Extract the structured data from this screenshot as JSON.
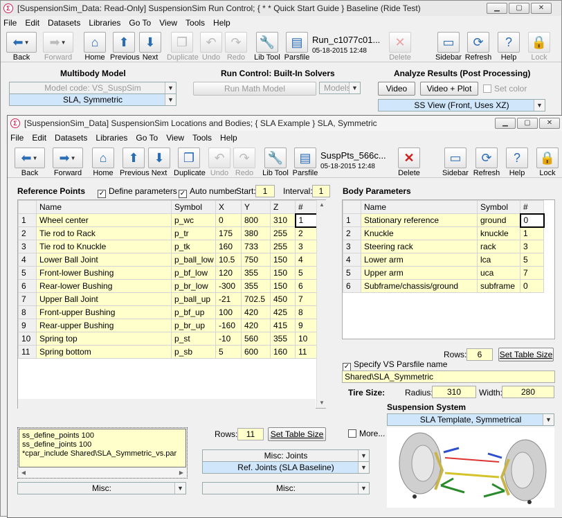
{
  "back_window": {
    "title": "[SuspensionSim_Data: Read-Only] SuspensionSim Run Control; { * * Quick Start Guide } Baseline (Ride Test)",
    "menu": [
      "File",
      "Edit",
      "Datasets",
      "Libraries",
      "Go To",
      "View",
      "Tools",
      "Help"
    ],
    "toolbar": {
      "back": "Back",
      "forward": "Forward",
      "home": "Home",
      "previous": "Previous",
      "next": "Next",
      "duplicate": "Duplicate",
      "undo": "Undo",
      "redo": "Redo",
      "lib_tool": "Lib Tool",
      "parsfile": "Parsfile",
      "dataset_name": "Run_c1077c01...",
      "dataset_date": "05-18-2015 12:48",
      "delete": "Delete",
      "sidebar": "Sidebar",
      "refresh": "Refresh",
      "help": "Help",
      "lock": "Lock"
    },
    "multibody": {
      "heading": "Multibody Model",
      "model_code": "Model code: VS_SuspSim",
      "model_link": "SLA, Symmetric"
    },
    "run_control": {
      "heading": "Run Control: Built-In Solvers",
      "run_button": "Run Math Model",
      "models": "Models"
    },
    "analyze": {
      "heading": "Analyze Results (Post Processing)",
      "video": "Video",
      "video_plot": "Video + Plot",
      "set_color": "Set color",
      "view": "SS View (Front, Uses XZ)"
    }
  },
  "front_window": {
    "title": "[SuspensionSim_Data] SuspensionSim Locations and Bodies; { SLA Example } SLA, Symmetric",
    "menu": [
      "File",
      "Edit",
      "Datasets",
      "Libraries",
      "Go To",
      "View",
      "Tools",
      "Help"
    ],
    "toolbar": {
      "back": "Back",
      "forward": "Forward",
      "home": "Home",
      "previous": "Previous",
      "next": "Next",
      "duplicate": "Duplicate",
      "undo": "Undo",
      "redo": "Redo",
      "lib_tool": "Lib Tool",
      "parsfile": "Parsfile",
      "dataset_name": "SuspPts_566c...",
      "dataset_date": "05-18-2015 12:48",
      "delete": "Delete",
      "sidebar": "Sidebar",
      "refresh": "Refresh",
      "help": "Help",
      "lock": "Lock"
    },
    "ref_points": {
      "heading": "Reference Points",
      "define_params": "Define parameters",
      "auto_number": "Auto number",
      "start_label": "Start:",
      "start_value": "1",
      "interval_label": "Interval:",
      "interval_value": "1",
      "columns": [
        "Name",
        "Symbol",
        "X",
        "Y",
        "Z",
        "#"
      ],
      "rows": [
        [
          "1",
          "Wheel center",
          "p_wc",
          "0",
          "800",
          "310",
          "1"
        ],
        [
          "2",
          "Tie rod to Rack",
          "p_tr",
          "175",
          "380",
          "255",
          "2"
        ],
        [
          "3",
          "Tie rod to Knuckle",
          "p_tk",
          "160",
          "733",
          "255",
          "3"
        ],
        [
          "4",
          "Lower Ball Joint",
          "p_ball_low",
          "10.5",
          "750",
          "150",
          "4"
        ],
        [
          "5",
          "Front-lower Bushing",
          "p_bf_low",
          "120",
          "355",
          "150",
          "5"
        ],
        [
          "6",
          "Rear-lower Bushing",
          "p_br_low",
          "-300",
          "355",
          "150",
          "6"
        ],
        [
          "7",
          "Upper Ball Joint",
          "p_ball_up",
          "-21",
          "702.5",
          "450",
          "7"
        ],
        [
          "8",
          "Front-upper Bushing",
          "p_bf_up",
          "100",
          "420",
          "425",
          "8"
        ],
        [
          "9",
          "Rear-upper Bushing",
          "p_br_up",
          "-160",
          "420",
          "415",
          "9"
        ],
        [
          "10",
          "Spring top",
          "p_st",
          "-10",
          "560",
          "355",
          "10"
        ],
        [
          "11",
          "Spring bottom",
          "p_sb",
          "5",
          "600",
          "160",
          "11"
        ]
      ],
      "rows_label": "Rows:",
      "rows_value": "11",
      "set_table_size": "Set Table Size"
    },
    "misc_text": [
      "ss_define_points 100",
      "ss_define_joints 100",
      "*cpar_include Shared\\SLA_Symmetric_vs.par"
    ],
    "more": "More...",
    "misc_joints": "Misc: Joints",
    "ref_joints": "Ref. Joints (SLA Baseline)",
    "misc1": "Misc:",
    "misc2": "Misc:",
    "body_params": {
      "heading": "Body Parameters",
      "columns": [
        "Name",
        "Symbol",
        "#"
      ],
      "rows": [
        [
          "1",
          "Stationary reference",
          "ground",
          "0"
        ],
        [
          "2",
          "Knuckle",
          "knuckle",
          "1"
        ],
        [
          "3",
          "Steering rack",
          "rack",
          "3"
        ],
        [
          "4",
          "Lower arm",
          "lca",
          "5"
        ],
        [
          "5",
          "Upper arm",
          "uca",
          "7"
        ],
        [
          "6",
          "Subframe/chassis/ground",
          "subframe",
          "0"
        ]
      ],
      "rows_label": "Rows:",
      "rows_value": "6",
      "set_table_size": "Set Table Size"
    },
    "parsfile": {
      "specify_label": "Specify VS Parsfile name",
      "name": "Shared\\SLA_Symmetric"
    },
    "tire": {
      "heading": "Tire Size:",
      "radius_label": "Radius:",
      "radius": "310",
      "width_label": "Width:",
      "width": "280"
    },
    "suspension_system": {
      "heading": "Suspension System",
      "template": "SLA Template, Symmetrical"
    }
  }
}
